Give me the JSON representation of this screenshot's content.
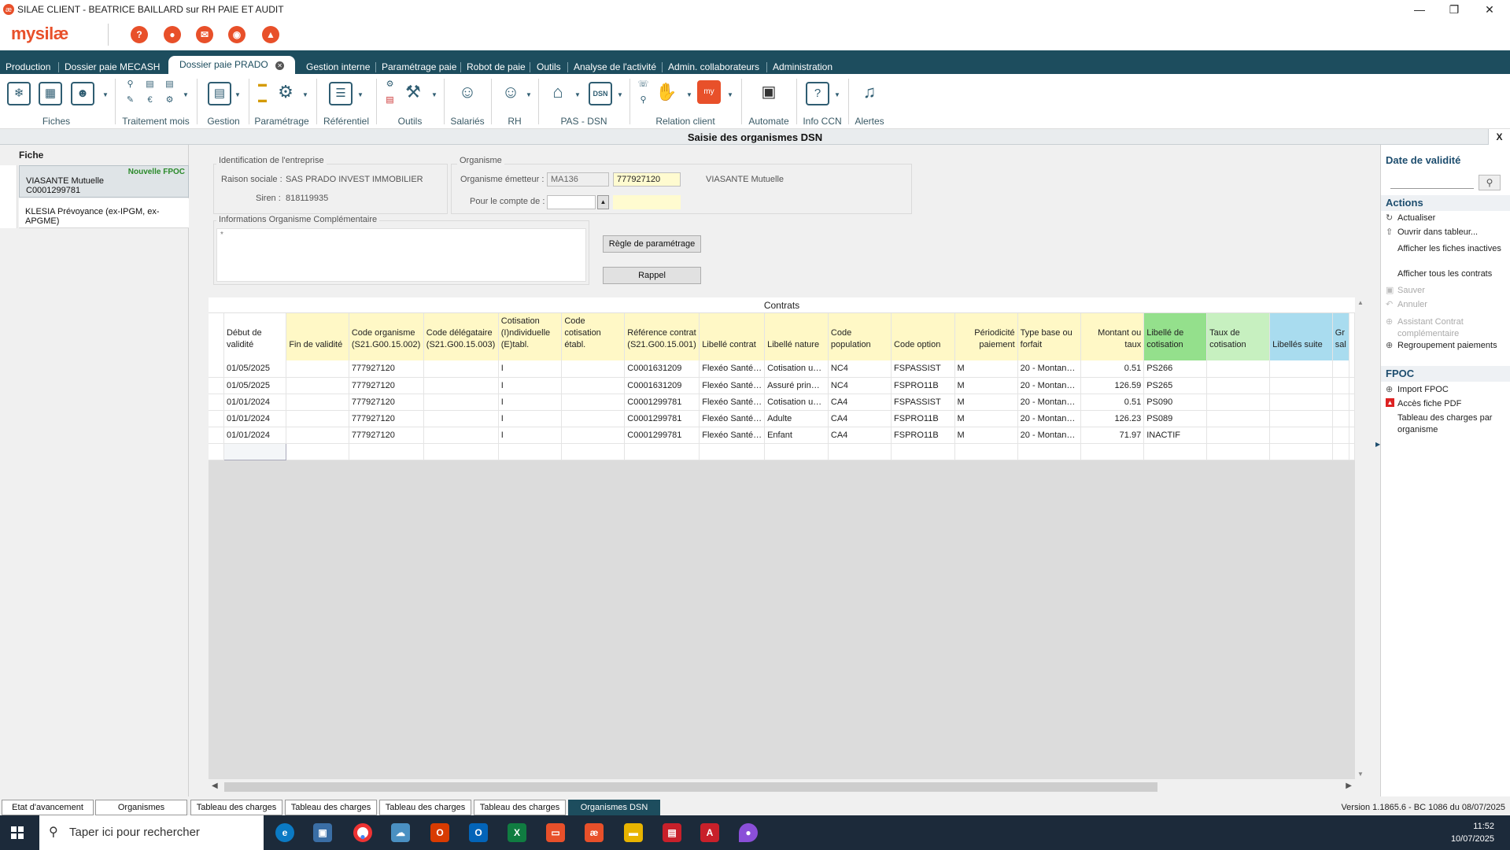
{
  "window": {
    "title": "SILAE CLIENT - BEATRICE BAILLARD sur RH PAIE ET AUDIT",
    "minimize": "—",
    "restore": "❐",
    "close": "✕"
  },
  "logo": {
    "brand": "mysilæ"
  },
  "menu": {
    "items": [
      "Production",
      "Dossier paie MECASH",
      "Dossier paie PRADO",
      "Gestion interne",
      "Paramétrage paie",
      "Robot de paie",
      "Outils",
      "Analyse de l'activité",
      "Admin. collaborateurs",
      "Administration"
    ],
    "active": "Dossier paie PRADO"
  },
  "ribbon": {
    "groups": [
      "Fiches",
      "Traitement mois",
      "Gestion",
      "Paramétrage",
      "Référentiel",
      "Outils",
      "Salariés",
      "RH",
      "PAS - DSN",
      "Relation client",
      "Automate",
      "Info CCN",
      "Alertes"
    ]
  },
  "panel": {
    "title": "Saisie des organismes DSN",
    "close": "X"
  },
  "left": {
    "header": "Fiche",
    "items": [
      {
        "line1": "VIASANTE Mutuelle",
        "line2": "C0001299781",
        "tag": "Nouvelle FPOC"
      },
      {
        "line1": "KLESIA Prévoyance (ex-IPGM, ex-APGME)",
        "line2": "",
        "tag": ""
      }
    ]
  },
  "identification": {
    "legend": "Identification de l'entreprise",
    "raison_label": "Raison sociale :",
    "raison_value": "SAS PRADO INVEST IMMOBILIER",
    "siren_label": "Siren :",
    "siren_value": "818119935"
  },
  "organisme": {
    "legend": "Organisme",
    "emetteur_label": "Organisme émetteur :",
    "emetteur_code": "MA136",
    "emetteur_value": "777927120",
    "emetteur_name": "VIASANTE Mutuelle",
    "compte_label": "Pour le compte de :"
  },
  "infos": {
    "legend": "Informations Organisme Complémentaire",
    "text": "*"
  },
  "buttons": {
    "regle": "Règle de paramétrage",
    "rappel": "Rappel"
  },
  "grid": {
    "title": "Contrats",
    "columns": [
      {
        "label": "Début de validité",
        "color": "white"
      },
      {
        "label": "Fin de validité",
        "color": "yellow"
      },
      {
        "label": "Code organisme (S21.G00.15.002)",
        "color": "yellow"
      },
      {
        "label": "Code délégataire (S21.G00.15.003)",
        "color": "yellow"
      },
      {
        "label": "Cotisation (I)ndividuelle (E)tabl.",
        "color": "yellow"
      },
      {
        "label": "Code cotisation établ.",
        "color": "yellow"
      },
      {
        "label": "Référence contrat (S21.G00.15.001)",
        "color": "yellow"
      },
      {
        "label": "Libellé contrat",
        "color": "yellow"
      },
      {
        "label": "Libellé nature",
        "color": "yellow"
      },
      {
        "label": "Code population",
        "color": "yellow"
      },
      {
        "label": "Code option",
        "color": "yellow"
      },
      {
        "label": "Périodicité paiement",
        "color": "yellow"
      },
      {
        "label": "Type base ou forfait",
        "color": "yellow"
      },
      {
        "label": "Montant ou taux",
        "color": "yellow"
      },
      {
        "label": "Libellé de cotisation",
        "color": "green"
      },
      {
        "label": "Taux de cotisation",
        "color": "lightgreen"
      },
      {
        "label": "Libellés suite",
        "color": "blue"
      },
      {
        "label": "Gr sal",
        "color": "blue"
      }
    ],
    "rows": [
      [
        "01/05/2025",
        "",
        "777927120",
        "",
        "I",
        "",
        "C0001631209",
        "Flexéo Santé…",
        "Cotisation u…",
        "NC4",
        "FSPASSIST",
        "M",
        "20 - Montan…",
        "0.51",
        "PS266",
        "",
        "",
        ""
      ],
      [
        "01/05/2025",
        "",
        "777927120",
        "",
        "I",
        "",
        "C0001631209",
        "Flexéo Santé…",
        "Assuré prin…",
        "NC4",
        "FSPRO11B",
        "M",
        "20 - Montan…",
        "126.59",
        "PS265",
        "",
        "",
        ""
      ],
      [
        "01/01/2024",
        "",
        "777927120",
        "",
        "I",
        "",
        "C0001299781",
        "Flexéo Santé…",
        "Cotisation u…",
        "CA4",
        "FSPASSIST",
        "M",
        "20 - Montan…",
        "0.51",
        "PS090",
        "",
        "",
        ""
      ],
      [
        "01/01/2024",
        "",
        "777927120",
        "",
        "I",
        "",
        "C0001299781",
        "Flexéo Santé…",
        "Adulte",
        "CA4",
        "FSPRO11B",
        "M",
        "20 - Montan…",
        "126.23",
        "PS089",
        "",
        "",
        ""
      ],
      [
        "01/01/2024",
        "",
        "777927120",
        "",
        "I",
        "",
        "C0001299781",
        "Flexéo Santé…",
        "Enfant",
        "CA4",
        "FSPRO11B",
        "M",
        "20 - Montan…",
        "71.97",
        "INACTIF",
        "",
        "",
        ""
      ],
      [
        "",
        "",
        "",
        "",
        "",
        "",
        "",
        "",
        "",
        "",
        "",
        "",
        "",
        "",
        "",
        "",
        "",
        ""
      ]
    ]
  },
  "right": {
    "validity_title": "Date de validité",
    "actions_title": "Actions",
    "actions": [
      {
        "label": "Actualiser",
        "enabled": true
      },
      {
        "label": "Ouvrir dans tableur...",
        "enabled": true
      },
      {
        "label": "Afficher les fiches inactives",
        "enabled": true
      },
      {
        "label": "Afficher tous les contrats",
        "enabled": true
      },
      {
        "label": "Sauver",
        "enabled": false
      },
      {
        "label": "Annuler",
        "enabled": false
      },
      {
        "label": "Assistant Contrat complémentaire",
        "enabled": false
      },
      {
        "label": "Regroupement paiements",
        "enabled": true
      }
    ],
    "fpoc_title": "FPOC",
    "fpoc": [
      {
        "label": "Import FPOC"
      },
      {
        "label": "Accès fiche PDF"
      },
      {
        "label": "Tableau des charges par organisme"
      }
    ]
  },
  "bottom_tabs": [
    "Etat d'avancement",
    "Organismes",
    "Tableau des charges",
    "Tableau des charges",
    "Tableau des charges",
    "Tableau des charges",
    "Organismes DSN"
  ],
  "bottom_active": "Organismes DSN",
  "version": "Version 1.1865.6 - BC 1086 du 08/07/2025",
  "taskbar": {
    "search_placeholder": "Taper ici pour rechercher",
    "time": "11:52",
    "date": "10/07/2025"
  },
  "colors": {
    "menubar": "#1d4d5e",
    "accent": "#e8502a",
    "yellow_header": "#fff8c6",
    "green_header": "#94e08c",
    "blue_header": "#a9dcef"
  }
}
